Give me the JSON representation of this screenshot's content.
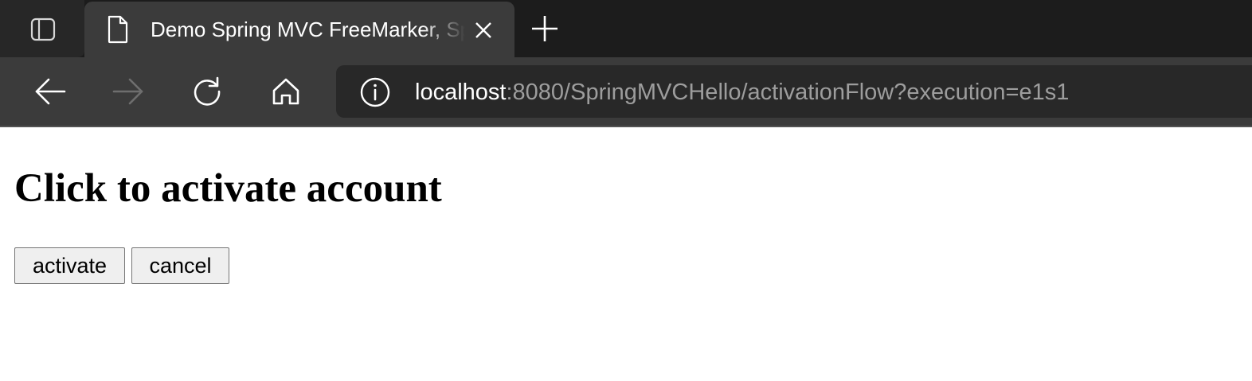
{
  "browser": {
    "tab": {
      "title": "Demo Spring MVC FreeMarker, Spring Web Flow"
    },
    "toolbar": {
      "back_icon": "arrow-left-icon",
      "forward_icon": "arrow-right-icon",
      "forward_enabled": false,
      "refresh_icon": "refresh-icon",
      "home_icon": "home-icon"
    },
    "address_bar": {
      "site_info_icon": "info-icon",
      "host": "localhost",
      "rest": ":8080/SpringMVCHello/activationFlow?execution=e1s1"
    },
    "colors": {
      "tabstrip_bg": "#1c1c1c",
      "active_tab_bg": "#3b3b3b",
      "omnibox_bg": "#282828",
      "url_host": "#ffffff",
      "url_rest": "#9d9d9d"
    }
  },
  "page": {
    "heading": "Click to activate account",
    "buttons": {
      "activate": "activate",
      "cancel": "cancel"
    }
  }
}
